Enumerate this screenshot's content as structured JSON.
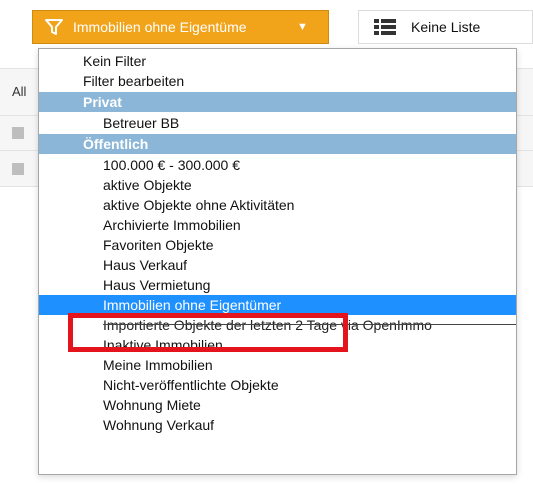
{
  "toolbar": {
    "filter_label": "Immobilien ohne Eigentüme",
    "list_label": "Keine Liste"
  },
  "background": {
    "row1_prefix": "All"
  },
  "dropdown": {
    "top_items": [
      "Kein Filter",
      "Filter bearbeiten"
    ],
    "groups": [
      {
        "title": "Privat",
        "items": [
          "Betreuer BB"
        ]
      },
      {
        "title": "Öffentlich",
        "items": [
          "100.000 € - 300.000 €",
          "aktive Objekte",
          "aktive Objekte ohne Aktivitäten",
          "Archivierte Immobilien",
          "Favoriten Objekte",
          "Haus Verkauf",
          "Haus Vermietung",
          "Immobilien ohne Eigentümer",
          "Importierte Objekte der letzten 2 Tage via OpenImmo",
          "Inaktive Immobilien",
          "Meine Immobilien",
          "Nicht-veröffentlichte Objekte",
          "Wohnung Miete",
          "Wohnung Verkauf"
        ]
      }
    ],
    "selected": "Immobilien ohne Eigentümer"
  },
  "colors": {
    "accent_orange": "#f1a31a",
    "group_header": "#8bb6d8",
    "selected_row": "#1e90ff",
    "highlight_box": "#e4141d"
  }
}
